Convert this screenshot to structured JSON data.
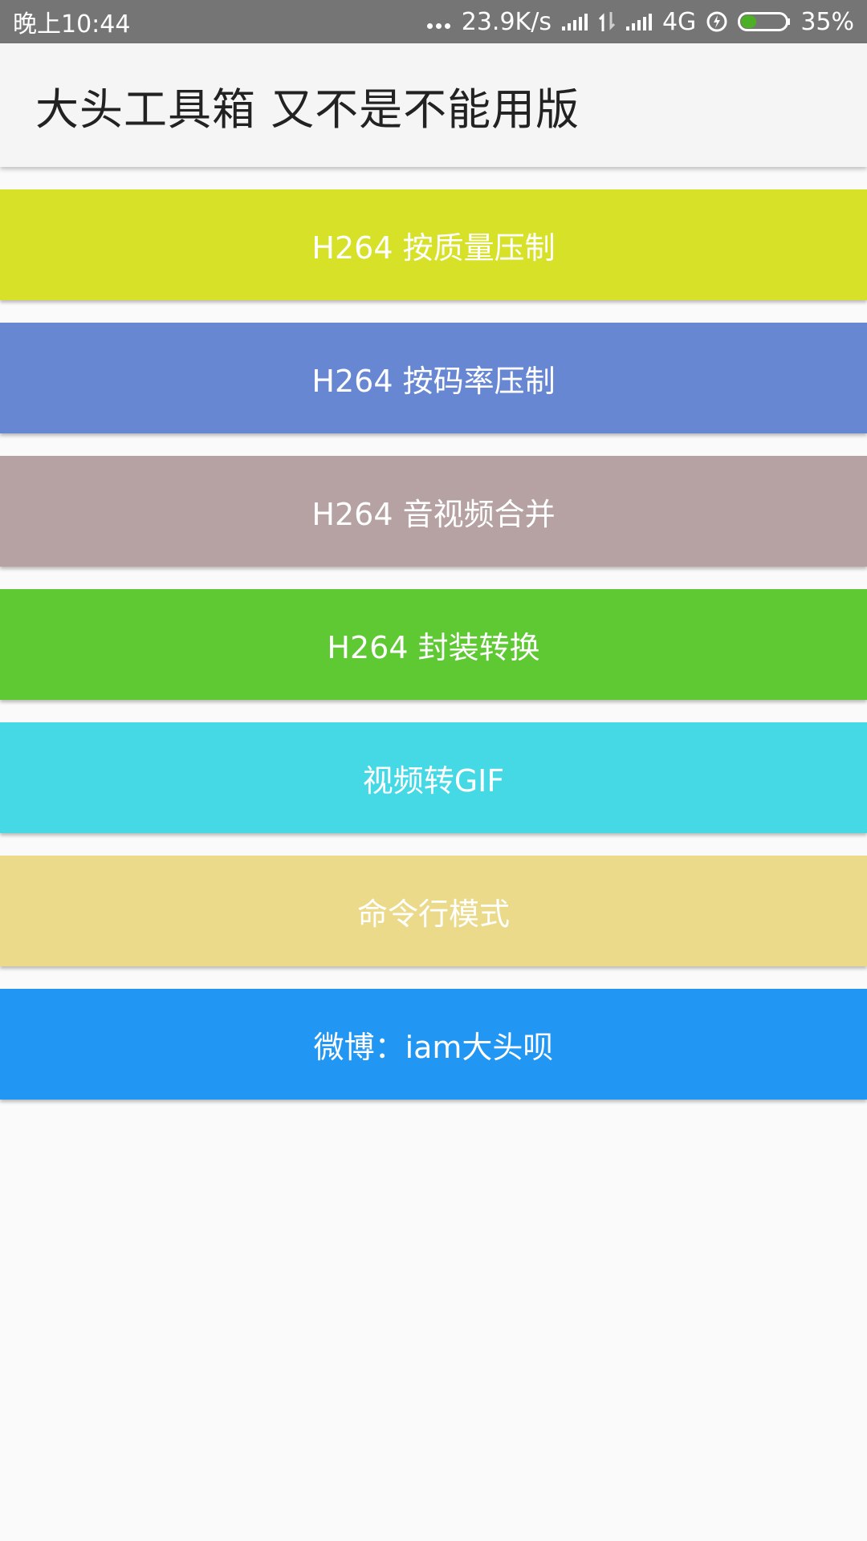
{
  "status_bar": {
    "time": "晚上10:44",
    "net_speed": "23.9K/s",
    "network_type": "4G",
    "battery_percent": "35%",
    "battery_level": 0.35,
    "battery_color": "#4caf26",
    "icons": [
      "more-dots-icon",
      "signal-icon",
      "data-arrows-icon",
      "signal-icon",
      "charge-icon",
      "battery-icon"
    ]
  },
  "app_bar": {
    "title": "大头工具箱 又不是不能用版"
  },
  "actions": [
    {
      "label": "H264 按质量压制",
      "color": "#d6e127"
    },
    {
      "label": "H264 按码率压制",
      "color": "#6787d3"
    },
    {
      "label": "H264 音视频合并",
      "color": "#b6a2a2"
    },
    {
      "label": "H264 封装转换",
      "color": "#5fc934"
    },
    {
      "label": "视频转GIF",
      "color": "#45d8e5"
    },
    {
      "label": "命令行模式",
      "color": "#eada89"
    },
    {
      "label": "微博：iam大头呗",
      "color": "#2196f3"
    }
  ]
}
